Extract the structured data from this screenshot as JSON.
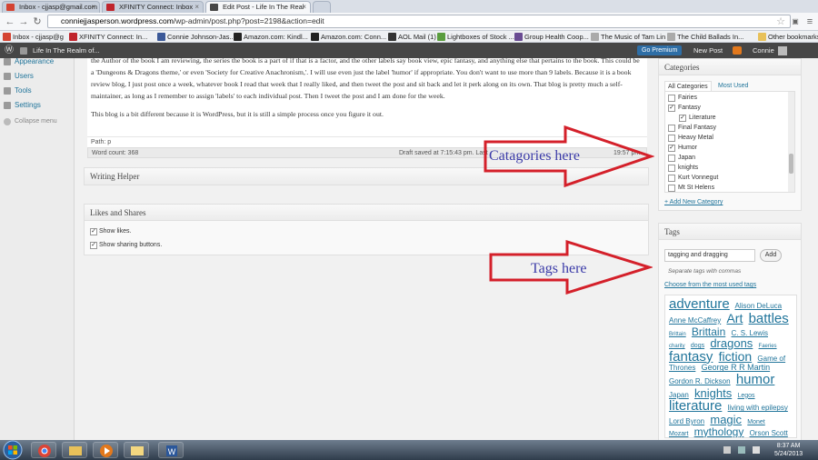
{
  "browser": {
    "tabs": [
      {
        "title": "Inbox - cjjasp@gmail.com",
        "icon_color": "#d44332"
      },
      {
        "title": "XFINITY Connect: Inbox",
        "icon_color": "#c0242c"
      },
      {
        "title": "Edit Post - Life In The Real",
        "icon_color": "#464646"
      },
      {
        "title": "",
        "icon_color": "#bfc6d0"
      }
    ],
    "url_host": "conniejjasperson.wordpress.com",
    "url_path": "/wp-admin/post.php?post=2198&action=edit",
    "bookmarks": [
      {
        "label": "Inbox - cjjasp@g",
        "icon_color": "#d44332"
      },
      {
        "label": "XFINITY Connect: In...",
        "icon_color": "#c0242c"
      },
      {
        "label": "Connie Johnson-Jas...",
        "icon_color": "#3b5998"
      },
      {
        "label": "Amazon.com: Kindl...",
        "icon_color": "#222"
      },
      {
        "label": "Amazon.com: Conn...",
        "icon_color": "#222"
      },
      {
        "label": "AOL Mail (1)",
        "icon_color": "#333"
      },
      {
        "label": "Lightboxes of Stock ...",
        "icon_color": "#5a9d3e"
      },
      {
        "label": "Group Health Coop...",
        "icon_color": "#6a4c93"
      },
      {
        "label": "The Music of Tam Lin",
        "icon_color": "#aaa"
      },
      {
        "label": "The Child Ballads In...",
        "icon_color": "#aaa"
      },
      {
        "label": "Other bookmarks",
        "icon_color": "#e8c15a"
      }
    ]
  },
  "adminbar": {
    "site_name": "Life In The Realm of...",
    "go_premium": "Go Premium",
    "new_post": "New Post",
    "user": "Connie"
  },
  "sidebar": {
    "items": [
      "Appearance",
      "Users",
      "Tools",
      "Settings"
    ],
    "collapse": "Collapse menu"
  },
  "editor": {
    "paragraphs": [
      "the Author of the book I am reviewing, the series the book is a part of if that is a factor, and the other labels say book view, epic fantasy, and anything else that pertains to the book. This could be a 'Dungeons & Dragons theme,' or even 'Society for Creative Anachronism,'. I will use even just the label 'humor' if appropriate. You don't want to use more than 9 labels. Because it is a book review blog, I just post once a week, whatever book I read that week that I really liked, and then tweet the post and sit back and let it perk along on its own. That blog is pretty much a self-maintainer, as long as I remember to assign 'labels' to each individual post. Then I tweet the post and I am done for the week.",
      "This blog is a bit different because it is WordPress, but it is still a simple process once you figure it out."
    ],
    "path": "Path: p",
    "word_count": "Word count: 368",
    "draft_saved": "Draft saved at 7:15:43 pm. Last",
    "last_edit_time": "19:57 pm"
  },
  "writing_helper": {
    "title": "Writing Helper"
  },
  "likes_shares": {
    "title": "Likes and Shares",
    "show_likes": "Show likes.",
    "show_sharing": "Show sharing buttons."
  },
  "categories": {
    "title": "Categories",
    "tab_all": "All Categories",
    "tab_most_used": "Most Used",
    "items": [
      {
        "label": "Fairies",
        "checked": false,
        "indent": 0
      },
      {
        "label": "Fantasy",
        "checked": true,
        "indent": 0
      },
      {
        "label": "Literature",
        "checked": true,
        "indent": 1
      },
      {
        "label": "Final Fantasy",
        "checked": false,
        "indent": 0
      },
      {
        "label": "Heavy Metal",
        "checked": false,
        "indent": 0
      },
      {
        "label": "Humor",
        "checked": true,
        "indent": 0
      },
      {
        "label": "Japan",
        "checked": false,
        "indent": 0
      },
      {
        "label": "knights",
        "checked": false,
        "indent": 0
      },
      {
        "label": "Kurt Vonnegut",
        "checked": false,
        "indent": 0
      },
      {
        "label": "Mt St Helens",
        "checked": false,
        "indent": 0
      }
    ],
    "add_new": "+ Add New Category"
  },
  "tags": {
    "title": "Tags",
    "input_value": "tagging and dragging",
    "add_button": "Add",
    "hint": "Separate tags with commas",
    "choose_link": "Choose from the most used tags",
    "cloud": [
      {
        "t": "adventure",
        "s": 15
      },
      {
        "t": "Alison DeLuca",
        "s": 8
      },
      {
        "t": "Anne McCaffrey",
        "s": 8
      },
      {
        "t": "Art",
        "s": 14
      },
      {
        "t": "battles",
        "s": 15
      },
      {
        "t": "Brittain",
        "s": 6
      },
      {
        "t": "Brittain",
        "s": 12
      },
      {
        "t": "C. S. Lewis",
        "s": 8
      },
      {
        "t": "charity",
        "s": 6
      },
      {
        "t": "dogs",
        "s": 7
      },
      {
        "t": "dragons",
        "s": 13
      },
      {
        "t": "Faeries",
        "s": 6
      },
      {
        "t": "fantasy",
        "s": 15
      },
      {
        "t": "fiction",
        "s": 14
      },
      {
        "t": "Game of Thrones",
        "s": 8
      },
      {
        "t": "George R R Martin",
        "s": 9
      },
      {
        "t": "Gordon R. Dickson",
        "s": 8
      },
      {
        "t": "humor",
        "s": 15
      },
      {
        "t": "Japan",
        "s": 8
      },
      {
        "t": "knights",
        "s": 13
      },
      {
        "t": "Legos",
        "s": 7
      },
      {
        "t": "literature",
        "s": 15
      },
      {
        "t": "living with epilepsy",
        "s": 8
      },
      {
        "t": "Lord Byron",
        "s": 8
      },
      {
        "t": "magic",
        "s": 13
      },
      {
        "t": "Monet",
        "s": 7
      },
      {
        "t": "Mozart",
        "s": 7
      },
      {
        "t": "mythology",
        "s": 12
      },
      {
        "t": "Orson Scott Card",
        "s": 8
      }
    ]
  },
  "annotations": {
    "categories": "Catagories here",
    "tags": "Tags here"
  },
  "taskbar": {
    "time": "8:37 AM",
    "date": "5/24/2013"
  },
  "colors": {
    "arrow": "#d4202a",
    "annotation_text": "#3b3ba8",
    "link": "#21759b"
  }
}
